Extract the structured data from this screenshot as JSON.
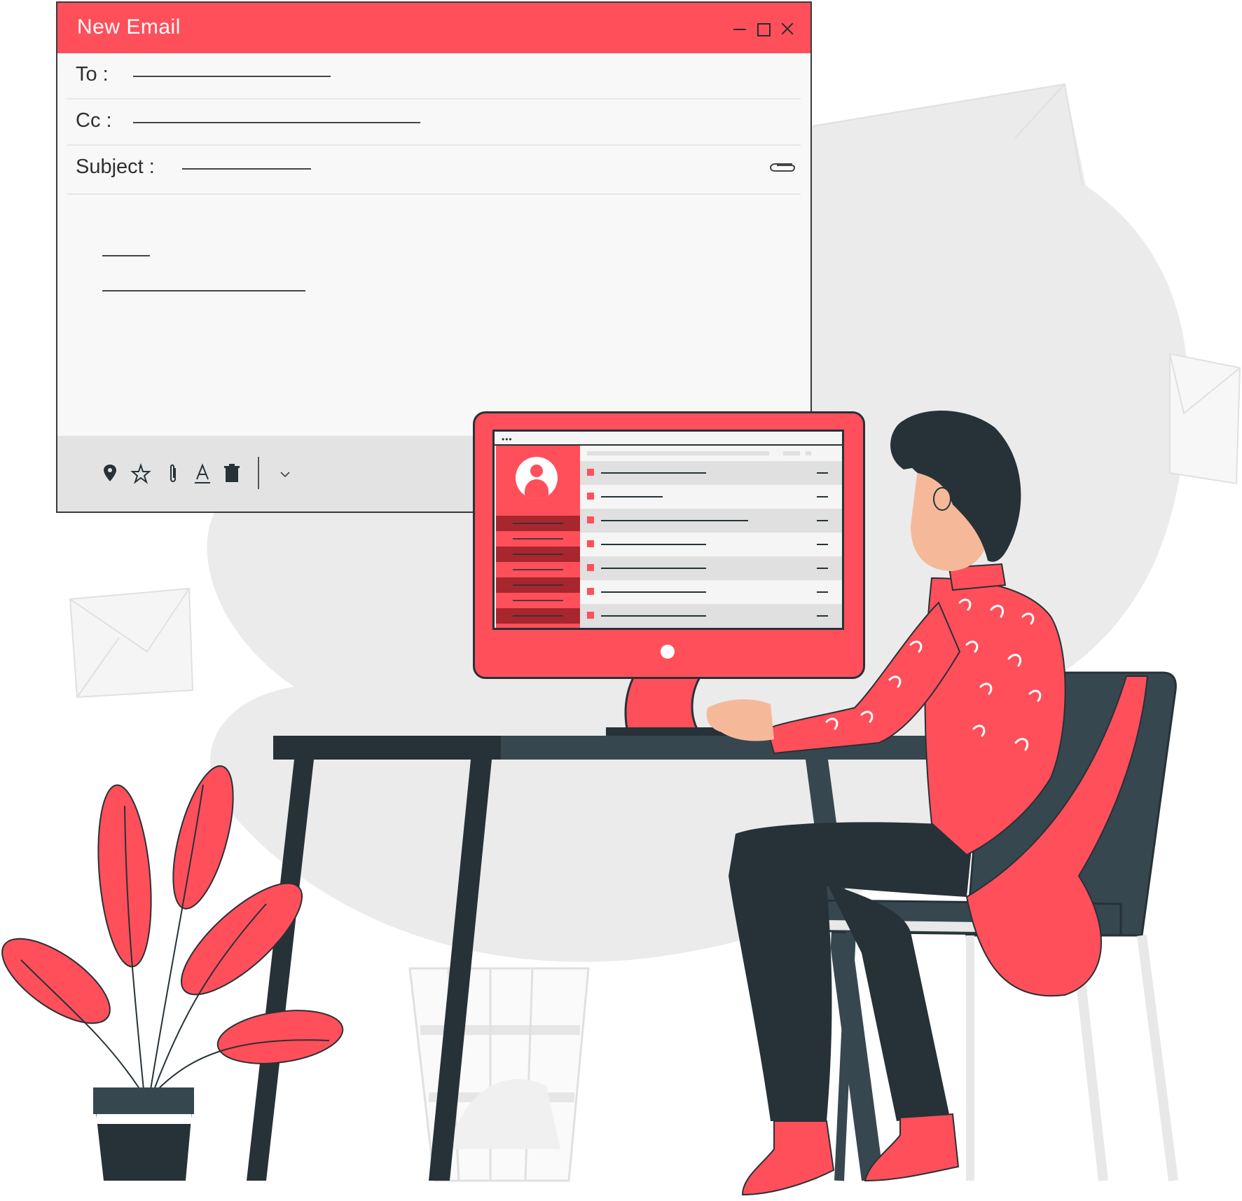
{
  "compose_window": {
    "title": "New Email",
    "to_label": "To :",
    "cc_label": "Cc :",
    "subject_label": "Subject :",
    "icons": {
      "minimize": "minimize-icon",
      "maximize": "maximize-icon",
      "close": "close-icon",
      "attach": "paperclip-icon"
    },
    "toolbar_icons": [
      "location-pin-icon",
      "star-icon",
      "paperclip-icon",
      "text-format-icon",
      "trash-icon",
      "chevron-down-icon"
    ]
  },
  "monitor_app": {
    "window_dots": "•••",
    "sidebar_icon": "user-avatar-icon",
    "mail_rows": 7
  },
  "colors": {
    "accent": "#ff4f5a",
    "dark": "#263238",
    "slate": "#37474f",
    "panel": "#f8f8f8",
    "toolbar": "#e3e3e3",
    "background_blob": "#ebebeb"
  }
}
